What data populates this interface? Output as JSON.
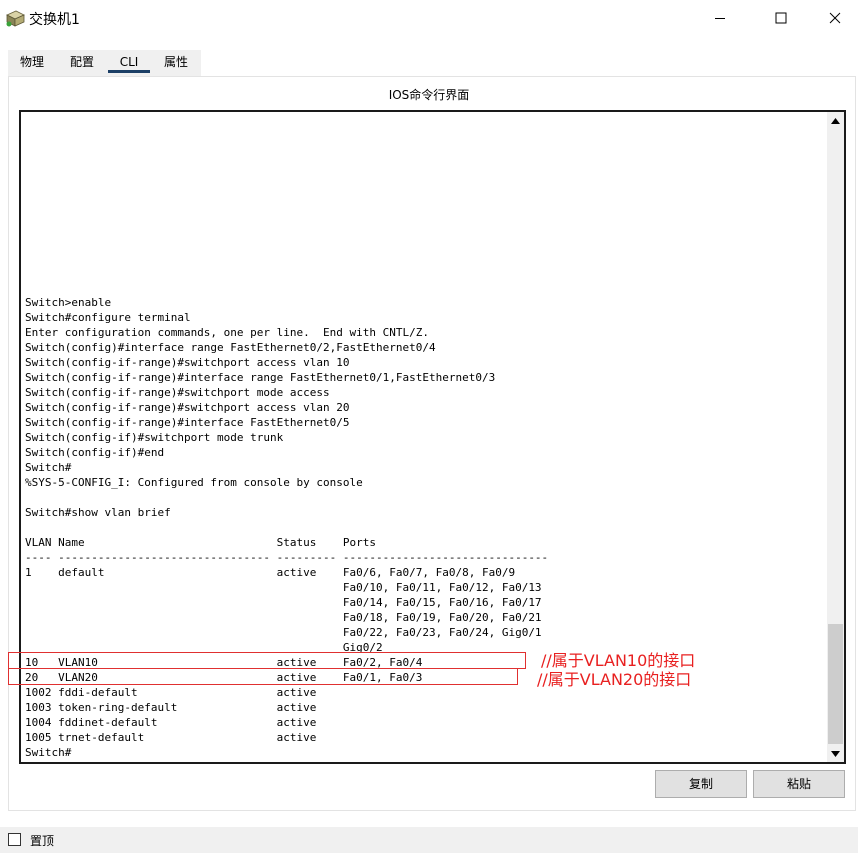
{
  "window": {
    "title": "交换机1",
    "icon": "switch-device-icon"
  },
  "tabs": [
    {
      "label": "物理"
    },
    {
      "label": "配置"
    },
    {
      "label": "CLI",
      "active": true
    },
    {
      "label": "属性"
    }
  ],
  "panel": {
    "heading": "IOS命令行界面"
  },
  "console": {
    "lines": [
      "Switch>enable",
      "Switch#configure terminal",
      "Enter configuration commands, one per line.  End with CNTL/Z.",
      "Switch(config)#interface range FastEthernet0/2,FastEthernet0/4",
      "Switch(config-if-range)#switchport access vlan 10",
      "Switch(config-if-range)#interface range FastEthernet0/1,FastEthernet0/3",
      "Switch(config-if-range)#switchport mode access",
      "Switch(config-if-range)#switchport access vlan 20",
      "Switch(config-if-range)#interface FastEthernet0/5",
      "Switch(config-if)#switchport mode trunk",
      "Switch(config-if)#end",
      "Switch#",
      "%SYS-5-CONFIG_I: Configured from console by console",
      "",
      "Switch#show vlan brief",
      "",
      "VLAN Name                             Status    Ports",
      "---- -------------------------------- --------- -------------------------------",
      "1    default                          active    Fa0/6, Fa0/7, Fa0/8, Fa0/9",
      "                                                Fa0/10, Fa0/11, Fa0/12, Fa0/13",
      "                                                Fa0/14, Fa0/15, Fa0/16, Fa0/17",
      "                                                Fa0/18, Fa0/19, Fa0/20, Fa0/21",
      "                                                Fa0/22, Fa0/23, Fa0/24, Gig0/1",
      "                                                Gig0/2",
      "10   VLAN10                           active    Fa0/2, Fa0/4",
      "20   VLAN20                           active    Fa0/1, Fa0/3",
      "1002 fddi-default                     active    ",
      "1003 token-ring-default               active    ",
      "1004 fddinet-default                  active    ",
      "1005 trnet-default                    active    ",
      "Switch#"
    ]
  },
  "annotations": {
    "vlan10": "//属于VLAN10的接口",
    "vlan20": "//属于VLAN20的接口",
    "color": "#e82020"
  },
  "buttons": {
    "copy": "复制",
    "paste": "粘贴"
  },
  "footer": {
    "pin_label": "置顶",
    "pin_checked": false
  }
}
